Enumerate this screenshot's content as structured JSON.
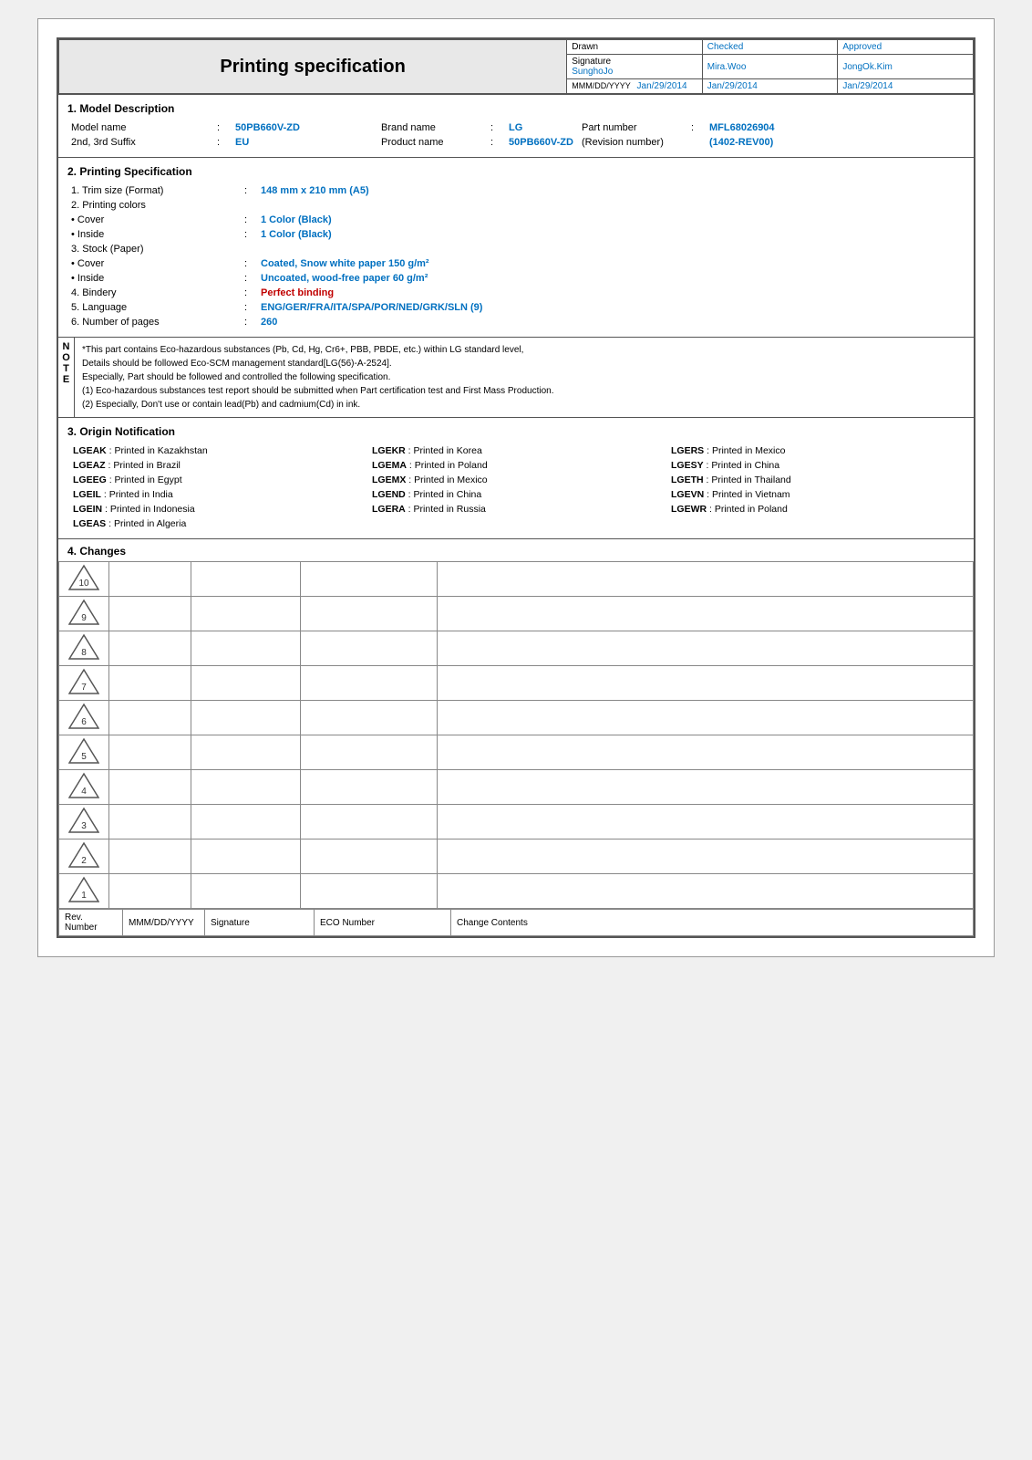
{
  "header": {
    "title": "Printing specification",
    "drawn_label": "Drawn",
    "checked_label": "Checked",
    "approved_label": "Approved",
    "signature_label": "Signature",
    "mmddyyyy_label": "MMM/DD/YYYY",
    "drawn_name": "SunghoJo",
    "drawn_date": "Jan/29/2014",
    "checked_name": "Mira.Woo",
    "checked_date": "Jan/29/2014",
    "approved_name": "JongOk.Kim",
    "approved_date": "Jan/29/2014"
  },
  "sections": {
    "model_description": {
      "title": "1. Model Description",
      "model_name_label": "Model name",
      "model_name_value": "50PB660V-ZD",
      "brand_name_label": "Brand name",
      "brand_name_value": "LG",
      "part_number_label": "Part number",
      "part_number_value": "MFL68026904",
      "suffix_label": "2nd, 3rd Suffix",
      "suffix_value": "EU",
      "product_name_label": "Product name",
      "product_name_value": "50PB660V-ZD",
      "revision_label": "(Revision number)",
      "revision_value": "(1402-REV00)"
    },
    "printing_spec": {
      "title": "2. Printing Specification",
      "trim_label": "1. Trim size (Format)",
      "trim_value": "148 mm x 210 mm (A5)",
      "printing_colors_label": "2. Printing colors",
      "cover_label": "• Cover",
      "cover_value": "1 Color (Black)",
      "inside_label": "• Inside",
      "inside_value": "1 Color (Black)",
      "stock_label": "3. Stock (Paper)",
      "stock_cover_label": "• Cover",
      "stock_cover_value": "Coated, Snow white paper 150 g/m²",
      "stock_inside_label": "• Inside",
      "stock_inside_value": "Uncoated, wood-free paper 60 g/m²",
      "bindery_label": "4. Bindery",
      "bindery_value": "Perfect binding",
      "language_label": "5. Language",
      "language_value": "ENG/GER/FRA/ITA/SPA/POR/NED/GRK/SLN (9)",
      "pages_label": "6. Number of pages",
      "pages_value": "260"
    },
    "notes": [
      "*This part contains Eco-hazardous substances (Pb, Cd, Hg, Cr6+, PBB, PBDE, etc.) within LG standard level,",
      "Details should be followed Eco-SCM management standard[LG(56)-A-2524].",
      "Especially, Part should be followed and controlled the following specification.",
      "(1) Eco-hazardous substances test report should be submitted when Part certification test and First Mass Production.",
      "(2) Especially, Don't use or contain lead(Pb) and cadmium(Cd) in ink."
    ],
    "note_letters": "NOTE",
    "origin": {
      "title": "3. Origin Notification",
      "entries": [
        [
          "LGEAK",
          "Printed in Kazakhstan",
          "LGEKR",
          "Printed in Korea",
          "LGERS",
          "Printed in Mexico"
        ],
        [
          "LGEAZ",
          "Printed in Brazil",
          "LGEMA",
          "Printed in Poland",
          "LGESY",
          "Printed in China"
        ],
        [
          "LGEEG",
          "Printed in Egypt",
          "LGEMX",
          "Printed in Mexico",
          "LGETH",
          "Printed in Thailand"
        ],
        [
          "LGEIL",
          "Printed in India",
          "LGEND",
          "Printed in China",
          "LGEVN",
          "Printed in Vietnam"
        ],
        [
          "LGEIN",
          "Printed in Indonesia",
          "LGERA",
          "Printed in Russia",
          "LGEWR",
          "Printed in Poland"
        ],
        [
          "LGEAS",
          "Printed in Algeria",
          "",
          "",
          "",
          ""
        ]
      ]
    },
    "changes": {
      "title": "4. Changes",
      "revisions": [
        10,
        9,
        8,
        7,
        6,
        5,
        4,
        3,
        2,
        1
      ],
      "footer": {
        "rev_number": "Rev. Number",
        "date": "MMM/DD/YYYY",
        "signature": "Signature",
        "eco_number": "ECO Number",
        "change_contents": "Change Contents"
      }
    }
  }
}
